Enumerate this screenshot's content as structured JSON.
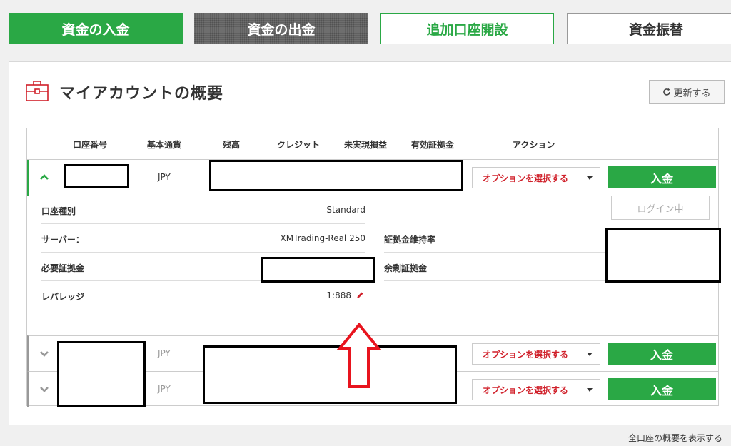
{
  "topbar": {
    "deposit": "資金の入金",
    "withdraw": "資金の出金",
    "open_account": "追加口座開設",
    "transfer": "資金振替"
  },
  "panel": {
    "title": "マイアカウントの概要",
    "refresh_label": "更新する",
    "icon": "briefcase-icon"
  },
  "table": {
    "headers": [
      "口座番号",
      "基本通貨",
      "残高",
      "クレジット",
      "未実現損益",
      "有効証拠金",
      "アクション"
    ],
    "rows": [
      {
        "currency": "JPY",
        "option_label": "オプションを選択する",
        "deposit_label": "入金",
        "expanded": true
      },
      {
        "currency": "JPY",
        "option_label": "オプションを選択する",
        "deposit_label": "入金",
        "expanded": false
      },
      {
        "currency": "JPY",
        "option_label": "オプションを選択する",
        "deposit_label": "入金",
        "expanded": false
      }
    ]
  },
  "details": {
    "account_type_label": "口座種別",
    "account_type_value": "Standard",
    "server_label": "サーバー：",
    "server_value": "XMTrading-Real 250",
    "required_margin_label": "必要証拠金",
    "leverage_label": "レバレッジ",
    "leverage_value": "1:888",
    "margin_level_label": "証拠金維持率",
    "free_margin_label": "余剰証拠金",
    "login_label": "ログイン中"
  },
  "footer": {
    "show_all": "全口座の概要を表示する"
  },
  "colors": {
    "accent_green": "#2aa845",
    "accent_red": "#d0202a"
  }
}
